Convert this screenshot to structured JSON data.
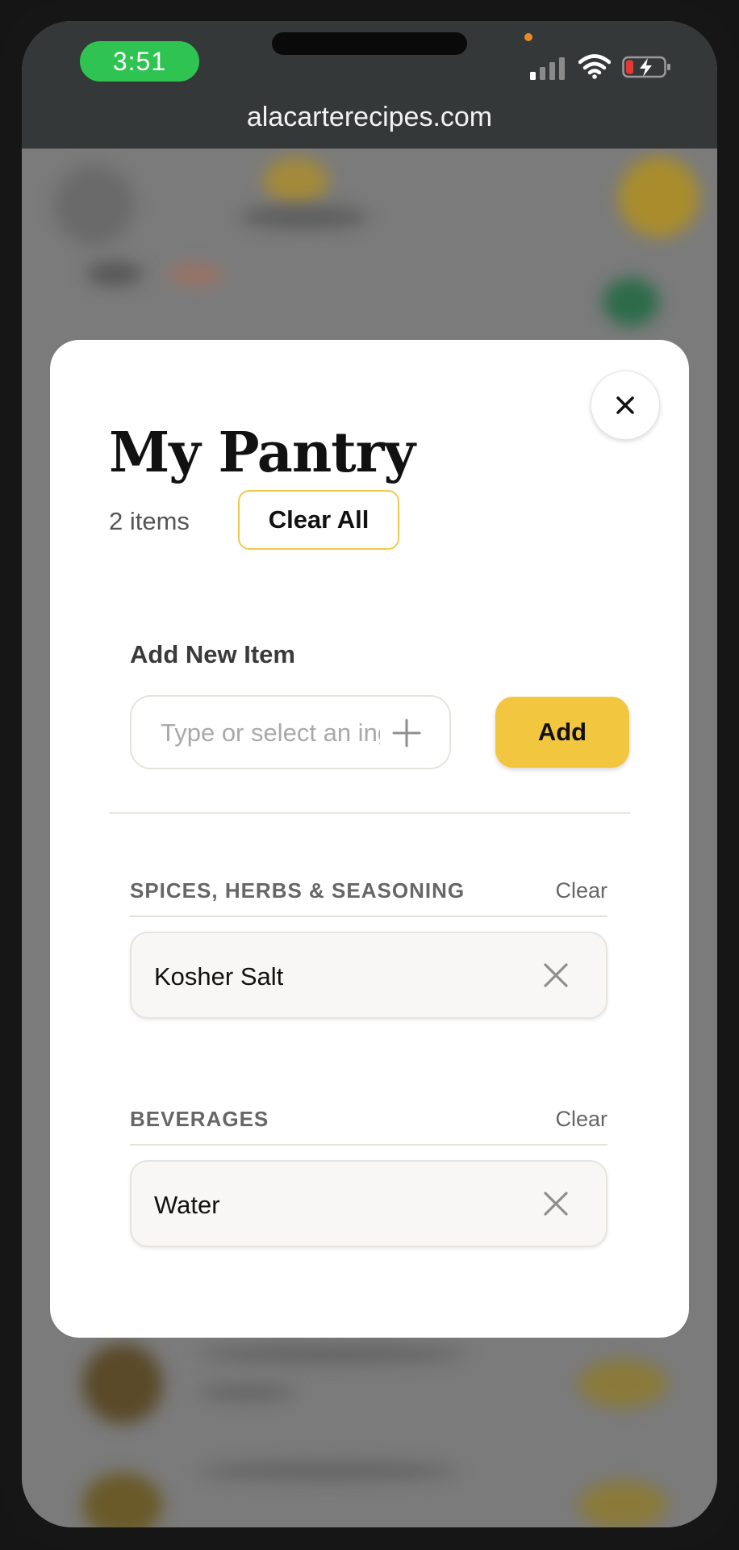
{
  "status_bar": {
    "time": "3:51"
  },
  "browser": {
    "url": "alacarterecipes.com"
  },
  "modal": {
    "title": "My Pantry",
    "item_count": "2 items",
    "clear_all_label": "Clear All",
    "add_section_label": "Add New Item",
    "input_placeholder": "Type or select an ingredient",
    "add_button_label": "Add",
    "categories": [
      {
        "name": "SPICES, HERBS & SEASONING",
        "clear_label": "Clear",
        "items": [
          "Kosher Salt"
        ]
      },
      {
        "name": "BEVERAGES",
        "clear_label": "Clear",
        "items": [
          "Water"
        ]
      }
    ]
  },
  "colors": {
    "accent": "#f3c63f",
    "status_green": "#2fc451",
    "topbar": "#353839"
  },
  "icons": [
    "close-icon",
    "plus-icon",
    "remove-item-icon",
    "signal-icon",
    "wifi-icon",
    "battery-icon"
  ]
}
